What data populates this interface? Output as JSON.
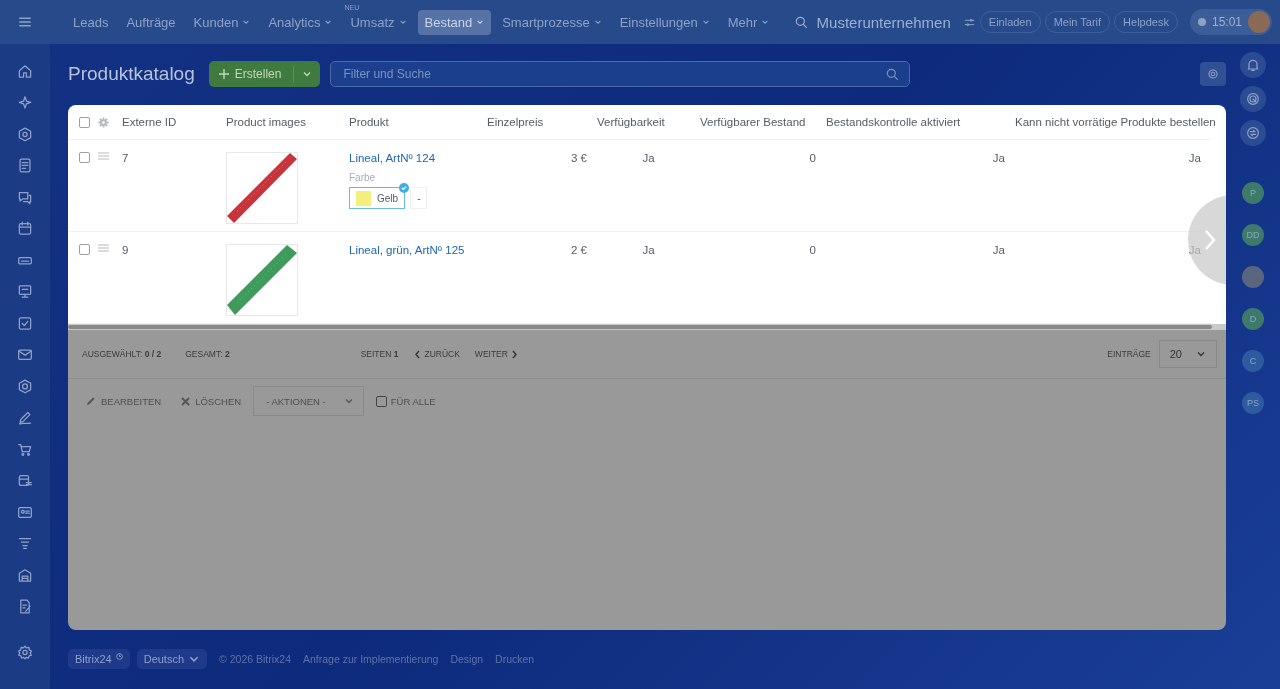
{
  "top_nav": {
    "items": [
      {
        "label": "Leads",
        "selected": false,
        "dropdown": false
      },
      {
        "label": "Aufträge",
        "selected": false,
        "dropdown": false
      },
      {
        "label": "Kunden",
        "selected": false,
        "dropdown": true
      },
      {
        "label": "Analytics",
        "selected": false,
        "dropdown": true
      },
      {
        "label": "Umsatz",
        "selected": false,
        "dropdown": true,
        "badge": "NEU"
      },
      {
        "label": "Bestand",
        "selected": true,
        "dropdown": true
      },
      {
        "label": "Smartprozesse",
        "selected": false,
        "dropdown": true
      },
      {
        "label": "Einstellungen",
        "selected": false,
        "dropdown": true
      },
      {
        "label": "Mehr",
        "selected": false,
        "dropdown": true
      }
    ],
    "company": "Musterunternehmen",
    "buttons": [
      "Einladen",
      "Mein Tarif",
      "Helpdesk"
    ],
    "time": "15:01"
  },
  "right_sidebar": {
    "avatars": [
      {
        "letters": "P",
        "color": "#3d7a6a"
      },
      {
        "letters": "DD",
        "color": "#3d7a6a"
      },
      {
        "letters": "D",
        "color": "#3d7a6a"
      },
      {
        "letters": "C",
        "color": "#2e5aa0"
      },
      {
        "letters": "PS",
        "color": "#2e5aa0"
      }
    ]
  },
  "page": {
    "title": "Produktkatalog",
    "create_button": "Erstellen",
    "search": {
      "placeholder": "Filter und Suche"
    }
  },
  "table": {
    "columns": [
      "Externe ID",
      "Product images",
      "Produkt",
      "Einzelpreis",
      "Verfügbarkeit",
      "Verfügbarer Bestand",
      "Bestandskontrolle aktiviert",
      "Kann nicht vorrätige Produkte bestellen"
    ],
    "header_checked": false,
    "rows": [
      {
        "checked": false,
        "id": "7",
        "product": "Lineal, ArtNº 124",
        "price": "3 €",
        "availability": "Ja",
        "stock": "0",
        "stock_control": "Ja",
        "can_order": "Ja",
        "variation": {
          "label": "Farbe",
          "options": [
            {
              "label": "Gelb",
              "color": "#f4ee7c",
              "selected": true
            },
            {
              "label": "-",
              "selected": false
            }
          ]
        }
      },
      {
        "checked": false,
        "id": "9",
        "product": "Lineal, grün, ArtNº 125",
        "price": "2 €",
        "availability": "Ja",
        "stock": "0",
        "stock_control": "Ja",
        "can_order": "Ja"
      }
    ]
  },
  "pager": {
    "selected": "AUSGEWÄHLT: **0 / 2**",
    "total": "GESAMT: **2**",
    "pages": "SEITEN **1**",
    "prev": "ZURÜCK",
    "next": "WEITER",
    "per_page_label": "EINTRÄGE",
    "per_page": "20"
  },
  "actions": {
    "edit": "BEARBEITEN",
    "delete": "LÖSCHEN",
    "dropdown": "- AKTIONEN -",
    "for_all": {
      "label": "FÜR ALLE",
      "checked": false
    }
  },
  "footer": {
    "brand": "Bitrix24",
    "language": "Deutsch",
    "copyright": "© 2026 Bitrix24",
    "links": [
      "Anfrage zur Implementierung",
      "Design",
      "Drucken"
    ]
  }
}
